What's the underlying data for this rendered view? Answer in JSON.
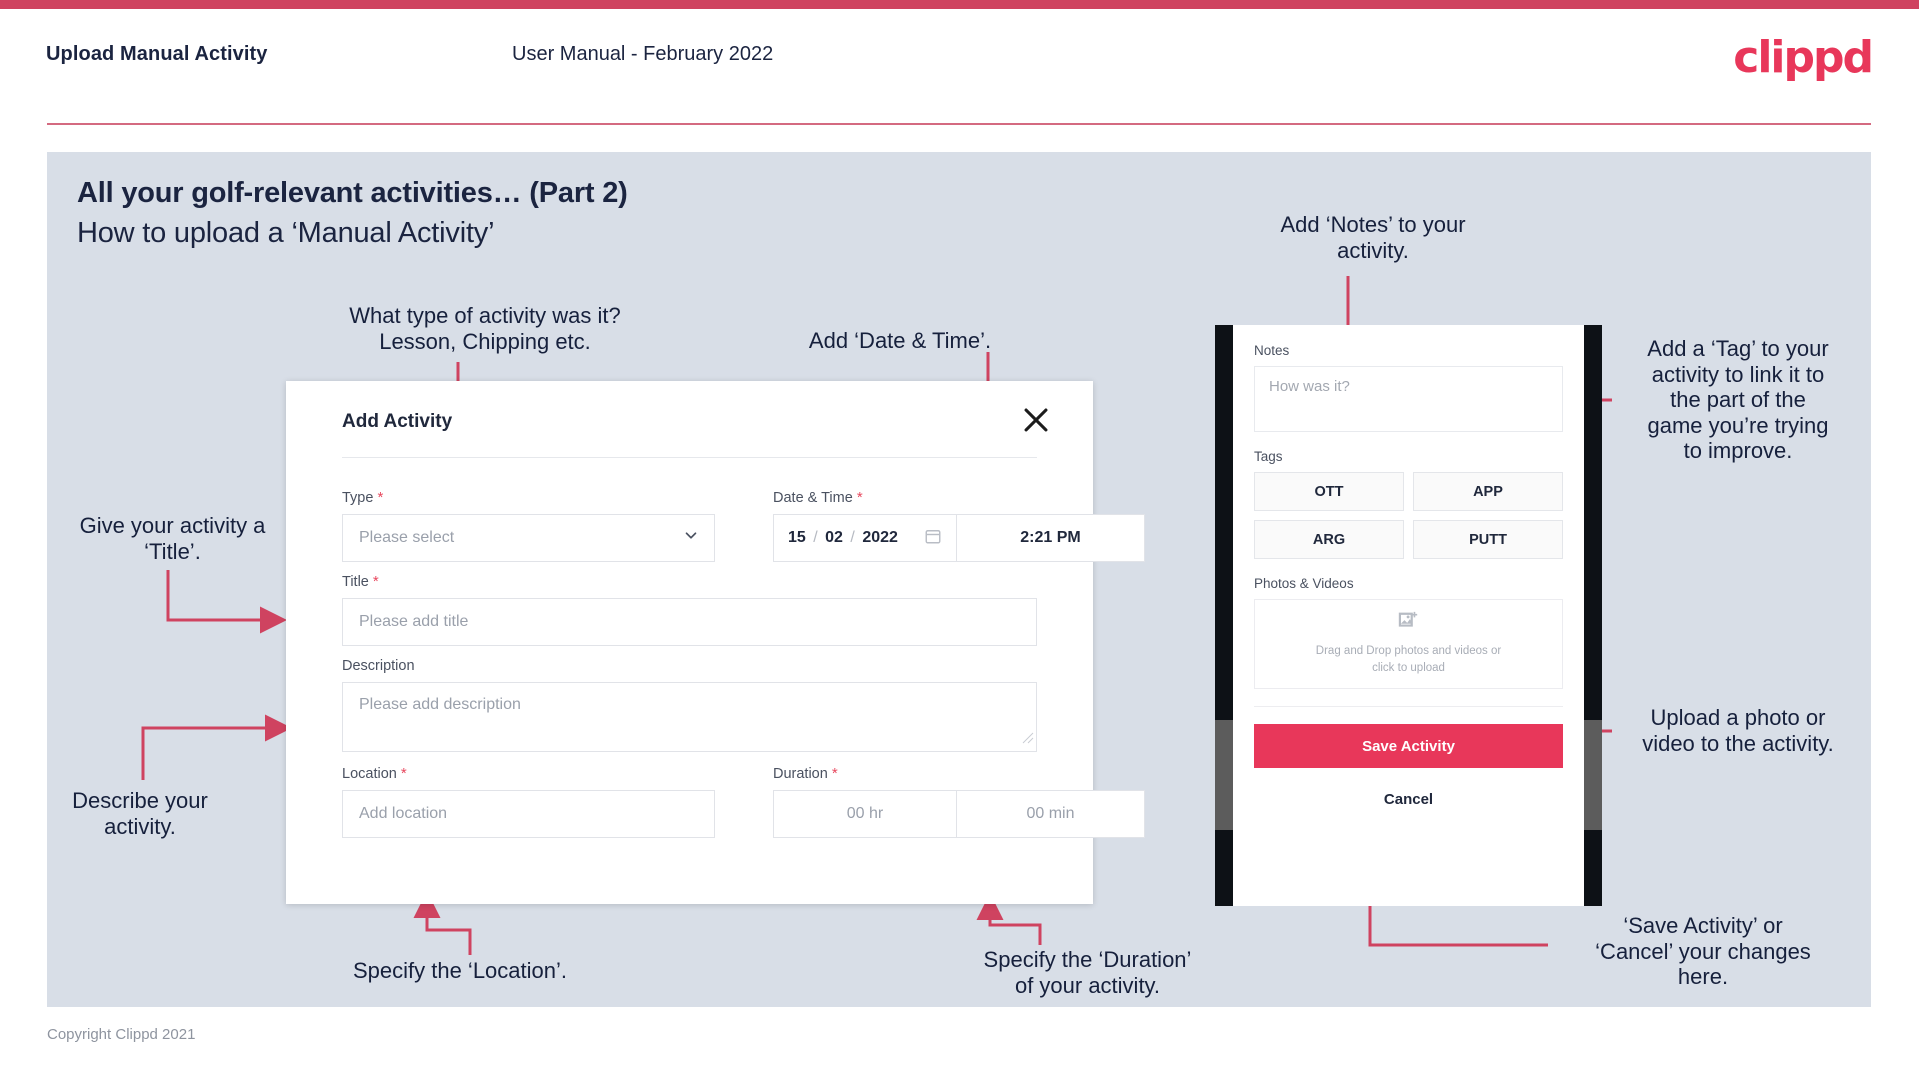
{
  "header": {
    "title": "Upload Manual Activity",
    "subtitle": "User Manual - February 2022",
    "logo": "clippd"
  },
  "slide": {
    "heading": "All your golf-relevant activities… (Part 2)",
    "subheading": "How to upload a ‘Manual Activity’"
  },
  "footer": {
    "copyright": "Copyright Clippd 2021"
  },
  "annotations": {
    "type": "What type of activity was it?\nLesson, Chipping etc.",
    "datetime": "Add ‘Date & Time’.",
    "title": "Give your activity a\n‘Title’.",
    "description": "Describe your\nactivity.",
    "location": "Specify the ‘Location’.",
    "duration": "Specify the ‘Duration’\nof your activity.",
    "notes": "Add ‘Notes’ to your\nactivity.",
    "tags": "Add a ‘Tag’ to your\nactivity to link it to\nthe part of the\ngame you’re trying\nto improve.",
    "upload": "Upload a photo or\nvideo to the activity.",
    "save": "‘Save Activity’ or\n‘Cancel’ your changes\nhere."
  },
  "modal": {
    "title": "Add Activity",
    "close_icon": "close-icon",
    "fields": {
      "type": {
        "label": "Type",
        "required": "*",
        "placeholder": "Please select",
        "icon": "chevron-down-icon"
      },
      "datetime": {
        "label": "Date & Time",
        "required": "*",
        "day": "15",
        "month": "02",
        "year": "2022",
        "sep": "/",
        "calendar_icon": "calendar-icon",
        "time": "2:21 PM"
      },
      "title": {
        "label": "Title",
        "required": "*",
        "placeholder": "Please add title"
      },
      "description": {
        "label": "Description",
        "required": "",
        "placeholder": "Please add description"
      },
      "location": {
        "label": "Location",
        "required": "*",
        "placeholder": "Add location"
      },
      "duration": {
        "label": "Duration",
        "required": "*",
        "hours": "00 hr",
        "minutes": "00 min"
      }
    }
  },
  "phone": {
    "notes": {
      "label": "Notes",
      "placeholder": "How was it?"
    },
    "tags": {
      "label": "Tags",
      "items": [
        "OTT",
        "APP",
        "ARG",
        "PUTT"
      ]
    },
    "photos": {
      "label": "Photos & Videos",
      "icon": "add-image-icon",
      "dropzone_line1": "Drag and Drop photos and videos or",
      "dropzone_line2": "click to upload"
    },
    "save_label": "Save Activity",
    "cancel_label": "Cancel"
  },
  "colors": {
    "accent": "#e8375a",
    "arrow": "#cf4360",
    "panel": "#d8dee7",
    "ink": "#1b2440"
  }
}
